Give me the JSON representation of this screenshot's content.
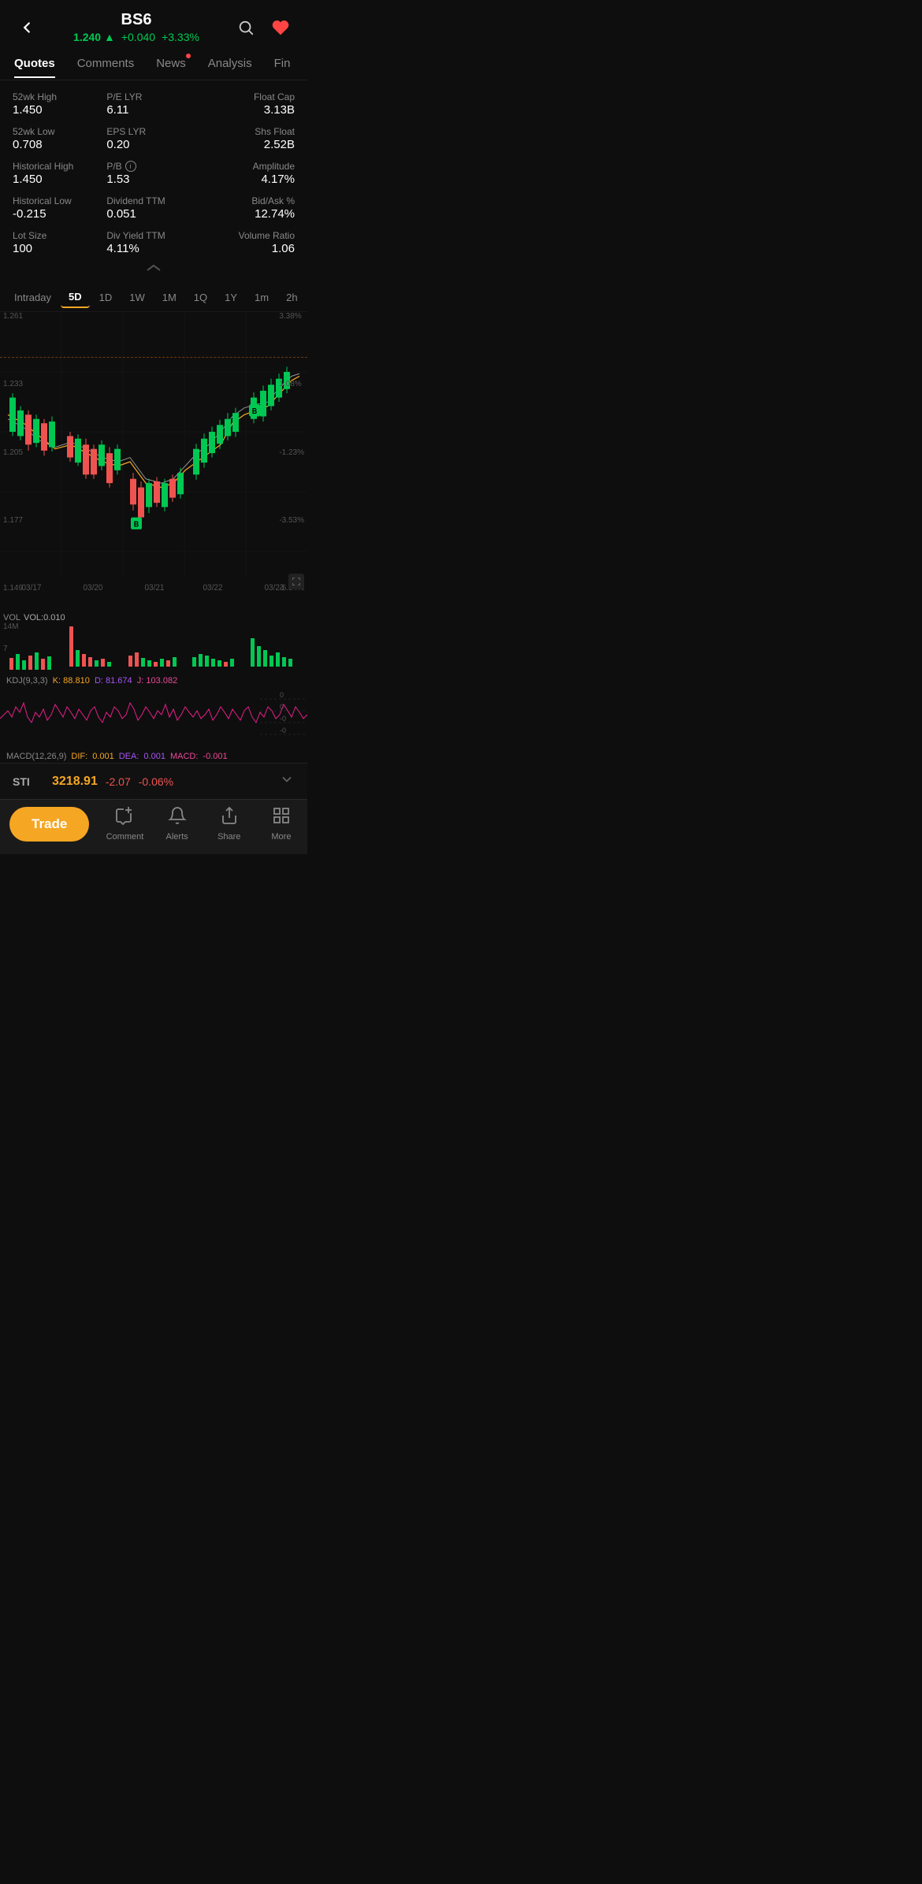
{
  "header": {
    "title": "BS6",
    "price": "1.240",
    "price_arrow": "▲",
    "change": "+0.040",
    "pct_change": "+3.33%",
    "back_icon": "←",
    "search_icon": "🔍",
    "heart_icon": "♥"
  },
  "tabs": [
    {
      "label": "Quotes",
      "active": true,
      "dot": false
    },
    {
      "label": "Comments",
      "active": false,
      "dot": false
    },
    {
      "label": "News",
      "active": false,
      "dot": true
    },
    {
      "label": "Analysis",
      "active": false,
      "dot": false
    },
    {
      "label": "Fin",
      "active": false,
      "dot": false
    }
  ],
  "stats": [
    {
      "label": "52wk High",
      "value": "1.450"
    },
    {
      "label": "P/E LYR",
      "value": "6.11"
    },
    {
      "label": "Float Cap",
      "value": "3.13B"
    },
    {
      "label": "52wk Low",
      "value": "0.708"
    },
    {
      "label": "EPS LYR",
      "value": "0.20"
    },
    {
      "label": "Shs Float",
      "value": "2.52B"
    },
    {
      "label": "Historical High",
      "value": "1.450"
    },
    {
      "label": "P/B",
      "value": "1.53",
      "has_info": true
    },
    {
      "label": "Amplitude",
      "value": "4.17%"
    },
    {
      "label": "Historical Low",
      "value": "-0.215"
    },
    {
      "label": "Dividend TTM",
      "value": "0.051"
    },
    {
      "label": "Bid/Ask %",
      "value": "12.74%"
    },
    {
      "label": "Lot Size",
      "value": "100"
    },
    {
      "label": "Div Yield TTM",
      "value": "4.11%"
    },
    {
      "label": "Volume Ratio",
      "value": "1.06"
    }
  ],
  "periods": [
    "Intraday",
    "5D",
    "1D",
    "1W",
    "1M",
    "1Q",
    "1Y",
    "1m",
    "2h"
  ],
  "active_period": "5D",
  "chart": {
    "y_labels_left": [
      "1.261",
      "1.233",
      "1.205",
      "1.177",
      "1.149"
    ],
    "y_labels_right": [
      "3.38%",
      "1.08%",
      "-1.23%",
      "-3.53%",
      "-5.84%"
    ],
    "x_labels": [
      "03/17",
      "03/20",
      "03/21",
      "03/22",
      "03/23"
    ],
    "dashed_line_pct": 15
  },
  "volume": {
    "label": "VOL",
    "value": "VOL:0.010",
    "max_label": "14M",
    "mid_label": "7"
  },
  "kdj": {
    "label": "KDJ(9,3,3)",
    "k_label": "K:",
    "k_value": "88.810",
    "d_label": "D:",
    "d_value": "81.674",
    "j_label": "J:",
    "j_value": "103.082"
  },
  "macd": {
    "label": "MACD(12,26,9)",
    "dif_label": "DIF:",
    "dif_value": "0.001",
    "dea_label": "DEA:",
    "dea_value": "0.001",
    "macd_label": "MACD:",
    "macd_value": "-0.001"
  },
  "sti": {
    "label": "STI",
    "price": "3218.91",
    "change": "-2.07",
    "pct": "-0.06%"
  },
  "bottom_nav": {
    "trade_label": "Trade",
    "items": [
      {
        "icon": "✏️",
        "label": "Comment"
      },
      {
        "icon": "🔔",
        "label": "Alerts"
      },
      {
        "icon": "⬆",
        "label": "Share"
      },
      {
        "icon": "⊞",
        "label": "More"
      }
    ]
  }
}
